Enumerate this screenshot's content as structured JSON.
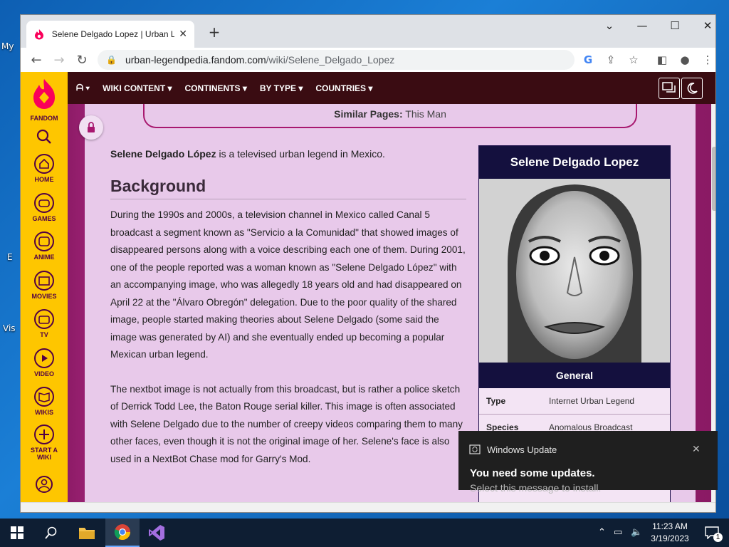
{
  "desktop": {
    "labels": [
      "My",
      "E",
      "Vis"
    ]
  },
  "browser": {
    "tab_title": "Selene Delgado Lopez | Urban Le",
    "url_host": "urban-legendpedia.fandom.com",
    "url_path": "/wiki/Selene_Delgado_Lopez",
    "new_tab_label": "+",
    "close_tab_label": "✕"
  },
  "fandom_rail": {
    "brand": "FANDOM",
    "items": [
      {
        "label": "HOME"
      },
      {
        "label": "GAMES"
      },
      {
        "label": "ANIME"
      },
      {
        "label": "MOVIES"
      },
      {
        "label": "TV"
      },
      {
        "label": "VIDEO"
      },
      {
        "label": "WIKIS"
      },
      {
        "label": "START A WIKI"
      }
    ]
  },
  "wiki_nav": {
    "items": [
      "WIKI CONTENT",
      "CONTINENTS",
      "BY TYPE",
      "COUNTRIES"
    ]
  },
  "article": {
    "similar_label": "Similar Pages:",
    "similar_value": "This Man",
    "intro_bold": "Selene Delgado López",
    "intro_rest": " is a televised urban legend in Mexico.",
    "heading": "Background",
    "para1": "During the 1990s and 2000s, a television channel in Mexico called Canal 5 broadcast a segment known as \"Servicio a la Comunidad\" that showed images of disappeared persons along with a voice describing each one of them. During 2001, one of the people reported was a woman known as \"Selene Delgado López\" with an accompanying image, who was allegedly 18 years old and had disappeared on April 22 at the \"Álvaro Obregón\" delegation. Due to the poor quality of the shared image, people started making theories about Selene Delgado (some said the image was generated by AI) and she eventually ended up becoming a popular Mexican urban legend.",
    "para2": "The nextbot image is not actually from this broadcast, but is rather a police sketch of Derrick Todd Lee, the Baton Rouge serial killer. This image is often associated with Selene Delgado due to the number of creepy videos comparing them to many other faces, even though it is not the original image of her. Selene's face is also used in a NextBot Chase mod for Garry's Mod."
  },
  "infobox": {
    "title": "Selene Delgado Lopez",
    "section": "General",
    "rows": [
      {
        "key": "Type",
        "value": "Internet Urban Legend"
      },
      {
        "key": "Species",
        "value": "Anomalous Broadcast"
      }
    ]
  },
  "toast": {
    "app": "Windows Update",
    "title": "You need some updates.",
    "body": "Select this message to install."
  },
  "taskbar": {
    "time": "11:23 AM",
    "date": "3/19/2023",
    "notification_count": "1"
  },
  "colors": {
    "fandom_yellow": "#fec600",
    "nav_bg": "#3a0c12",
    "infobox_header": "#14103e",
    "article_bg": "#e8c9ea"
  }
}
